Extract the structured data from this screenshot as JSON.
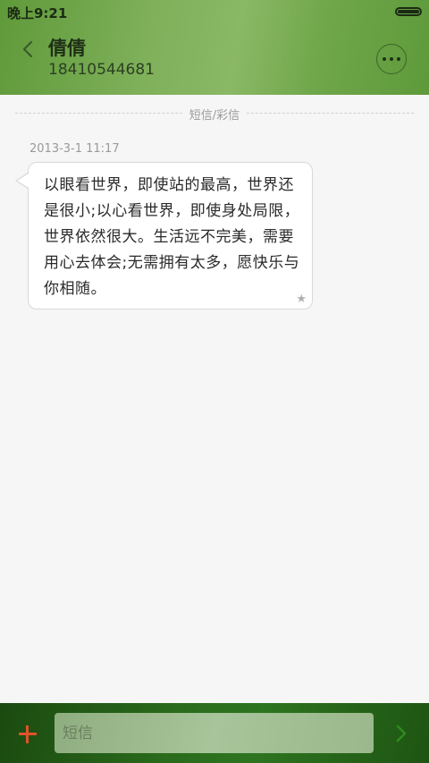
{
  "status_bar": {
    "time": "晚上9:21",
    "battery_level": 1.0
  },
  "header": {
    "contact_name": "倩倩",
    "contact_number": "18410544681",
    "back_icon": "chevron-left-icon",
    "more_icon": "more-dots-icon"
  },
  "conversation": {
    "divider_label": "短信/彩信",
    "messages": [
      {
        "timestamp": "2013-3-1 11:17",
        "text": "以眼看世界，即使站的最高，世界还是很小;以心看世界，即使身处局限，世界依然很大。生活远不完美，需要用心去体会;无需拥有太多，愿快乐与你相随。",
        "star_icon": "star-icon"
      }
    ]
  },
  "composer": {
    "add_icon": "plus-icon",
    "input_placeholder": "短信",
    "input_value": "",
    "send_icon": "send-arrow-icon"
  },
  "colors": {
    "header_green": "#7fb05a",
    "bottom_bar_green": "#2a6b1c",
    "add_button_orange": "#e0522a"
  }
}
